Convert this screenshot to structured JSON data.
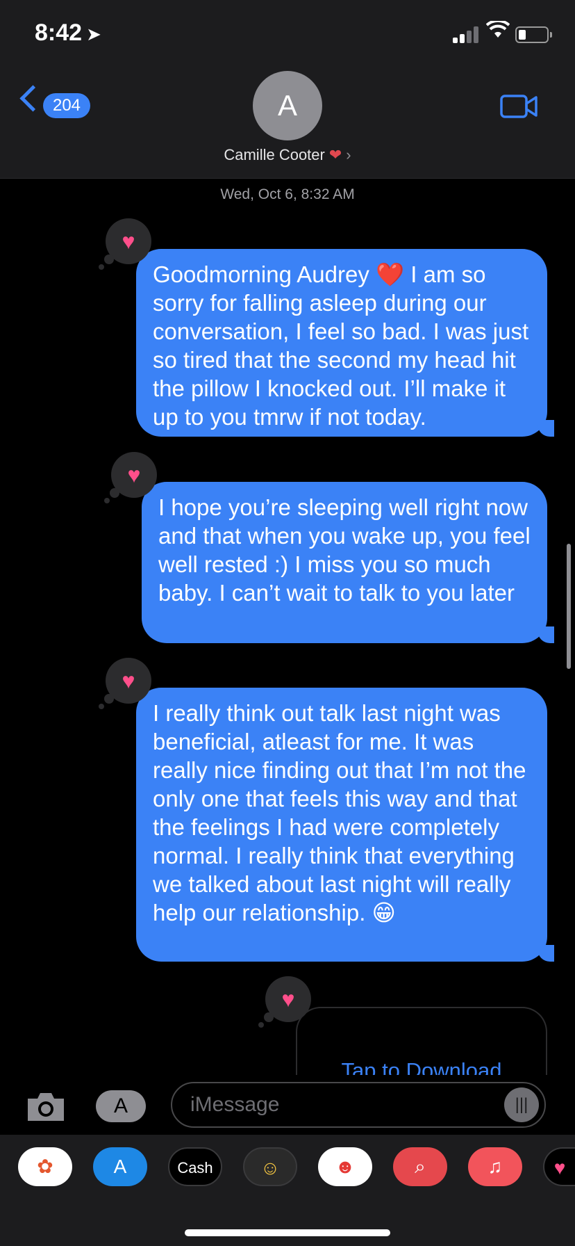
{
  "status": {
    "time": "8:42"
  },
  "nav": {
    "back_count": "204"
  },
  "contact": {
    "initial": "A",
    "name": "Camille Cooter"
  },
  "thread": {
    "timestamp": "Wed, Oct 6, 8:32 AM",
    "messages": [
      {
        "text": "Goodmorning Audrey ❤️ I am so sorry for falling asleep during our conversation, I feel so bad. I was just so tired that the second my head hit the pillow I knocked out. I’ll make it up to you tmrw if not today.",
        "tapback": "heart"
      },
      {
        "text": "I hope you’re sleeping well right now and that when you wake up, you feel well rested :) I miss you so much baby. I can’t wait to talk to you later",
        "tapback": "heart"
      },
      {
        "text": "I really think out talk last night was beneficial, atleast for me. It was really nice finding out that I’m not the only one that feels this way and that the feelings I had were completely normal. I really think that everything we talked about last night will really help our relationship. 😁",
        "tapback": "heart"
      }
    ],
    "attachment_link": "Tap to Download"
  },
  "composer": {
    "placeholder": "iMessage"
  },
  "app_drawer": {
    "cash_label": "Cash"
  },
  "colors": {
    "bubble": "#3b82f6",
    "tapback_heart": "#ff4f8b",
    "header": "#1c1c1e"
  }
}
